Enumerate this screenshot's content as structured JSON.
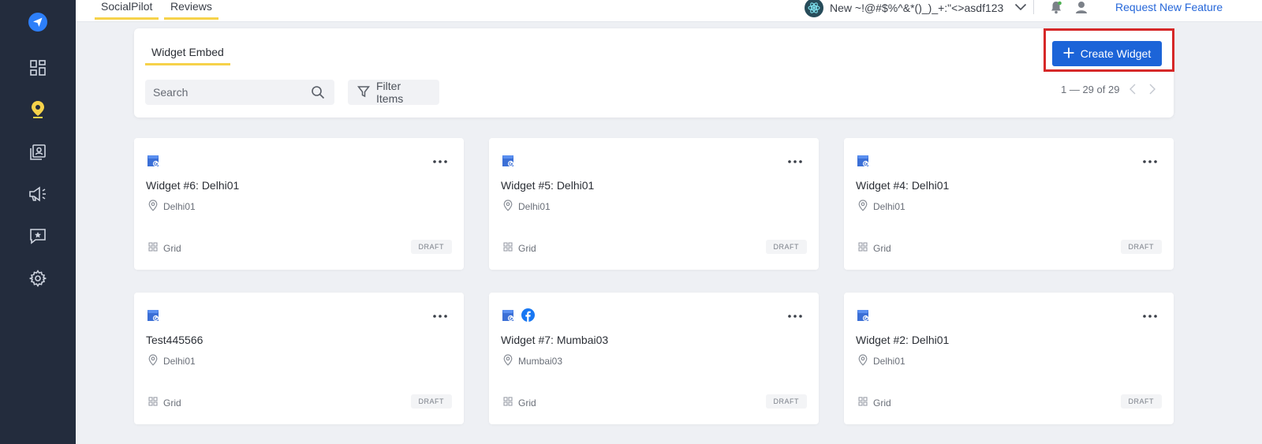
{
  "sidebar": {
    "items": [
      {
        "name": "send-logo-icon",
        "color": "#2d7ff9"
      },
      {
        "name": "dashboard-icon"
      },
      {
        "name": "location-pin-icon",
        "active": true,
        "color": "#f6d24a"
      },
      {
        "name": "contacts-icon"
      },
      {
        "name": "megaphone-icon"
      },
      {
        "name": "review-star-icon"
      },
      {
        "name": "settings-gear-icon"
      }
    ]
  },
  "topbar": {
    "tabs": [
      {
        "label": "SocialPilot"
      },
      {
        "label": "Reviews"
      }
    ],
    "workspace_name": "New ~!@#$%^&*()_)_+:\"<>asdf123",
    "request_feature": "Request New Feature"
  },
  "panel": {
    "tab_label": "Widget Embed",
    "search_placeholder": "Search",
    "filter_label": "Filter Items",
    "create_label": "Create Widget",
    "pagination": "1 — 29 of 29"
  },
  "widgets": [
    {
      "title": "Widget #6: Delhi01",
      "location": "Delhi01",
      "type": "Grid",
      "status": "DRAFT",
      "sources": [
        "google-business"
      ]
    },
    {
      "title": "Widget #5: Delhi01",
      "location": "Delhi01",
      "type": "Grid",
      "status": "DRAFT",
      "sources": [
        "google-business"
      ]
    },
    {
      "title": "Widget #4: Delhi01",
      "location": "Delhi01",
      "type": "Grid",
      "status": "DRAFT",
      "sources": [
        "google-business"
      ]
    },
    {
      "title": "Test445566",
      "location": "Delhi01",
      "type": "Grid",
      "status": "DRAFT",
      "sources": [
        "google-business"
      ]
    },
    {
      "title": "Widget #7: Mumbai03",
      "location": "Mumbai03",
      "type": "Grid",
      "status": "DRAFT",
      "sources": [
        "google-business",
        "facebook"
      ]
    },
    {
      "title": "Widget #2: Delhi01",
      "location": "Delhi01",
      "type": "Grid",
      "status": "DRAFT",
      "sources": [
        "google-business"
      ]
    }
  ],
  "colors": {
    "sidebar_bg": "#232c3d",
    "accent_yellow": "#f6d24a",
    "primary_blue": "#1c64d8",
    "highlight_red": "#d62828"
  }
}
